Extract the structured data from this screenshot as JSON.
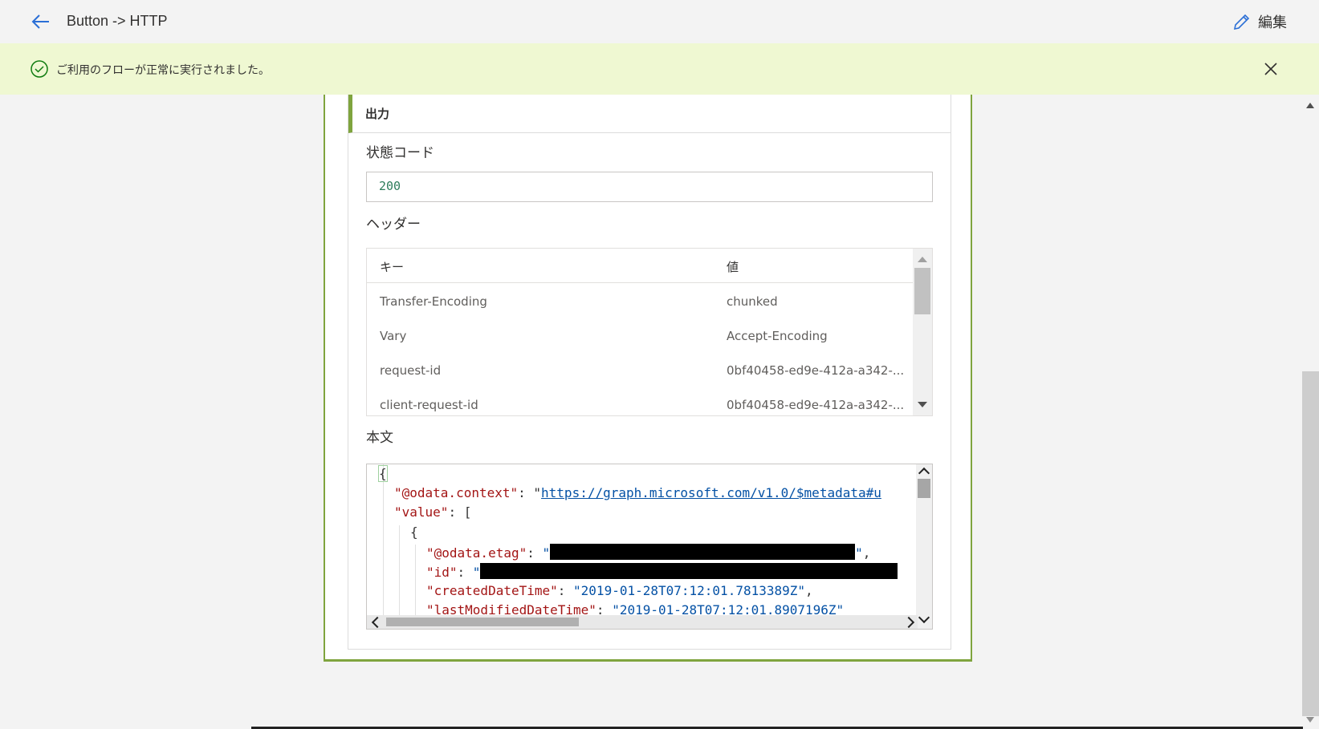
{
  "header": {
    "title": "Button -> HTTP",
    "edit_label": "編集",
    "back_icon": "arrow-left-icon",
    "edit_icon": "pencil-icon"
  },
  "banner": {
    "message": "ご利用のフローが正常に実行されました。",
    "success_icon": "check-circle-icon",
    "close_icon": "close-icon"
  },
  "output": {
    "section_title": "出力",
    "status_label": "状態コード",
    "status_value": "200",
    "headers_label": "ヘッダー",
    "headers_columns": [
      "キー",
      "値"
    ],
    "headers": [
      {
        "key": "Transfer-Encoding",
        "value": "chunked"
      },
      {
        "key": "Vary",
        "value": "Accept-Encoding"
      },
      {
        "key": "request-id",
        "value": "0bf40458-ed9e-412a-a342-..."
      },
      {
        "key": "client-request-id",
        "value": "0bf40458-ed9e-412a-a342-..."
      }
    ],
    "body_label": "本文",
    "body": {
      "open_brace": "{",
      "context_key": "\"@odata.context\"",
      "context_value": "https://graph.microsoft.com/v1.0/$metadata#u",
      "value_key": "\"value\"",
      "value_open": "[",
      "item_open": "{",
      "etag_key": "\"@odata.etag\"",
      "id_key": "\"id\"",
      "created_key": "\"createdDateTime\"",
      "created_value": "\"2019-01-28T07:12:01.7813389Z\"",
      "modified_key": "\"lastModifiedDateTime\"",
      "modified_value": "\"2019-01-28T07:12:01.8907196Z\""
    }
  },
  "colors": {
    "accent": "#7fa43e",
    "banner_bg": "#eff8d2",
    "link_blue": "#0078d4",
    "json_key": "#a31515",
    "json_string": "#0451a5",
    "status_code": "#2e7d5b"
  }
}
